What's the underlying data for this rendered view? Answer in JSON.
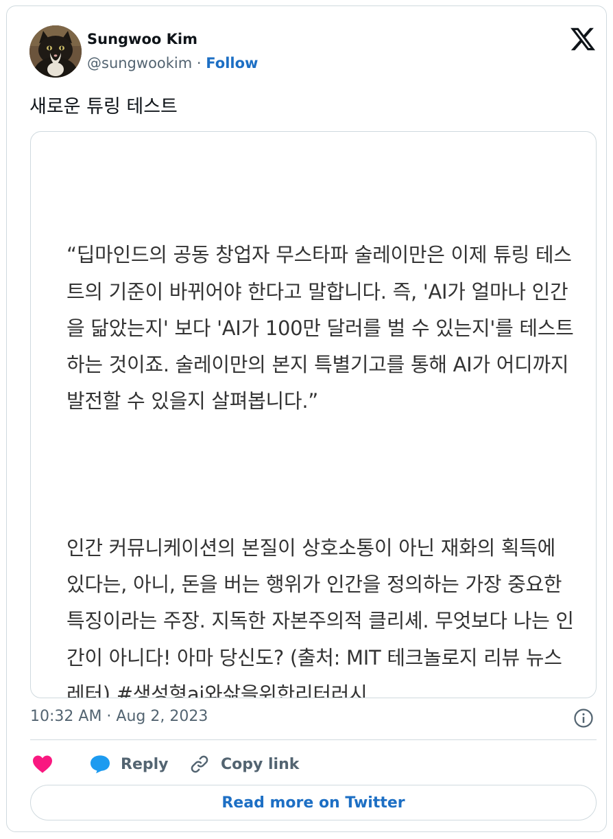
{
  "author": {
    "name": "Sungwoo Kim",
    "handle": "@sungwookim",
    "separator": "·",
    "follow_label": "Follow"
  },
  "tweet_text": "새로운 튜링 테스트",
  "media": {
    "paragraphs": [
      "“딥마인드의 공동 창업자 무스타파 술레이만은 이제 튜링 테스트의 기준이 바뀌어야 한다고 말합니다. 즉, 'AI가 얼마나 인간을 닮았는지' 보다 'AI가 100만 달러를 벌 수 있는지'를 테스트하는 것이죠. 술레이만의 본지 특별기고를 통해 AI가 어디까지 발전할 수 있을지 살펴봅니다.”",
      "인간 커뮤니케이션의 본질이 상호소통이 아닌 재화의 획득에 있다는, 아니, 돈을 버는 행위가 인간을 정의하는 가장 중요한 특징이라는 주장. 지독한 자본주의적 클리셰. 무엇보다 나는 인간이 아니다! 아마 당신도? (출처: MIT 테크놀로지 리뷰 뉴스레터) #생성형ai와삶을위한리터러시"
    ]
  },
  "timestamp": "10:32 AM · Aug 2, 2023",
  "actions": {
    "reply_label": "Reply",
    "copy_link_label": "Copy link"
  },
  "read_more_label": "Read more on Twitter",
  "colors": {
    "link_blue": "#1d6fc4",
    "heart_pink": "#f91880",
    "reply_blue": "#1d9bf0",
    "muted_text": "#536471",
    "border": "#cfd9de"
  },
  "icons": [
    "x-logo-icon",
    "info-icon",
    "heart-icon",
    "reply-bubble-icon",
    "link-icon"
  ]
}
